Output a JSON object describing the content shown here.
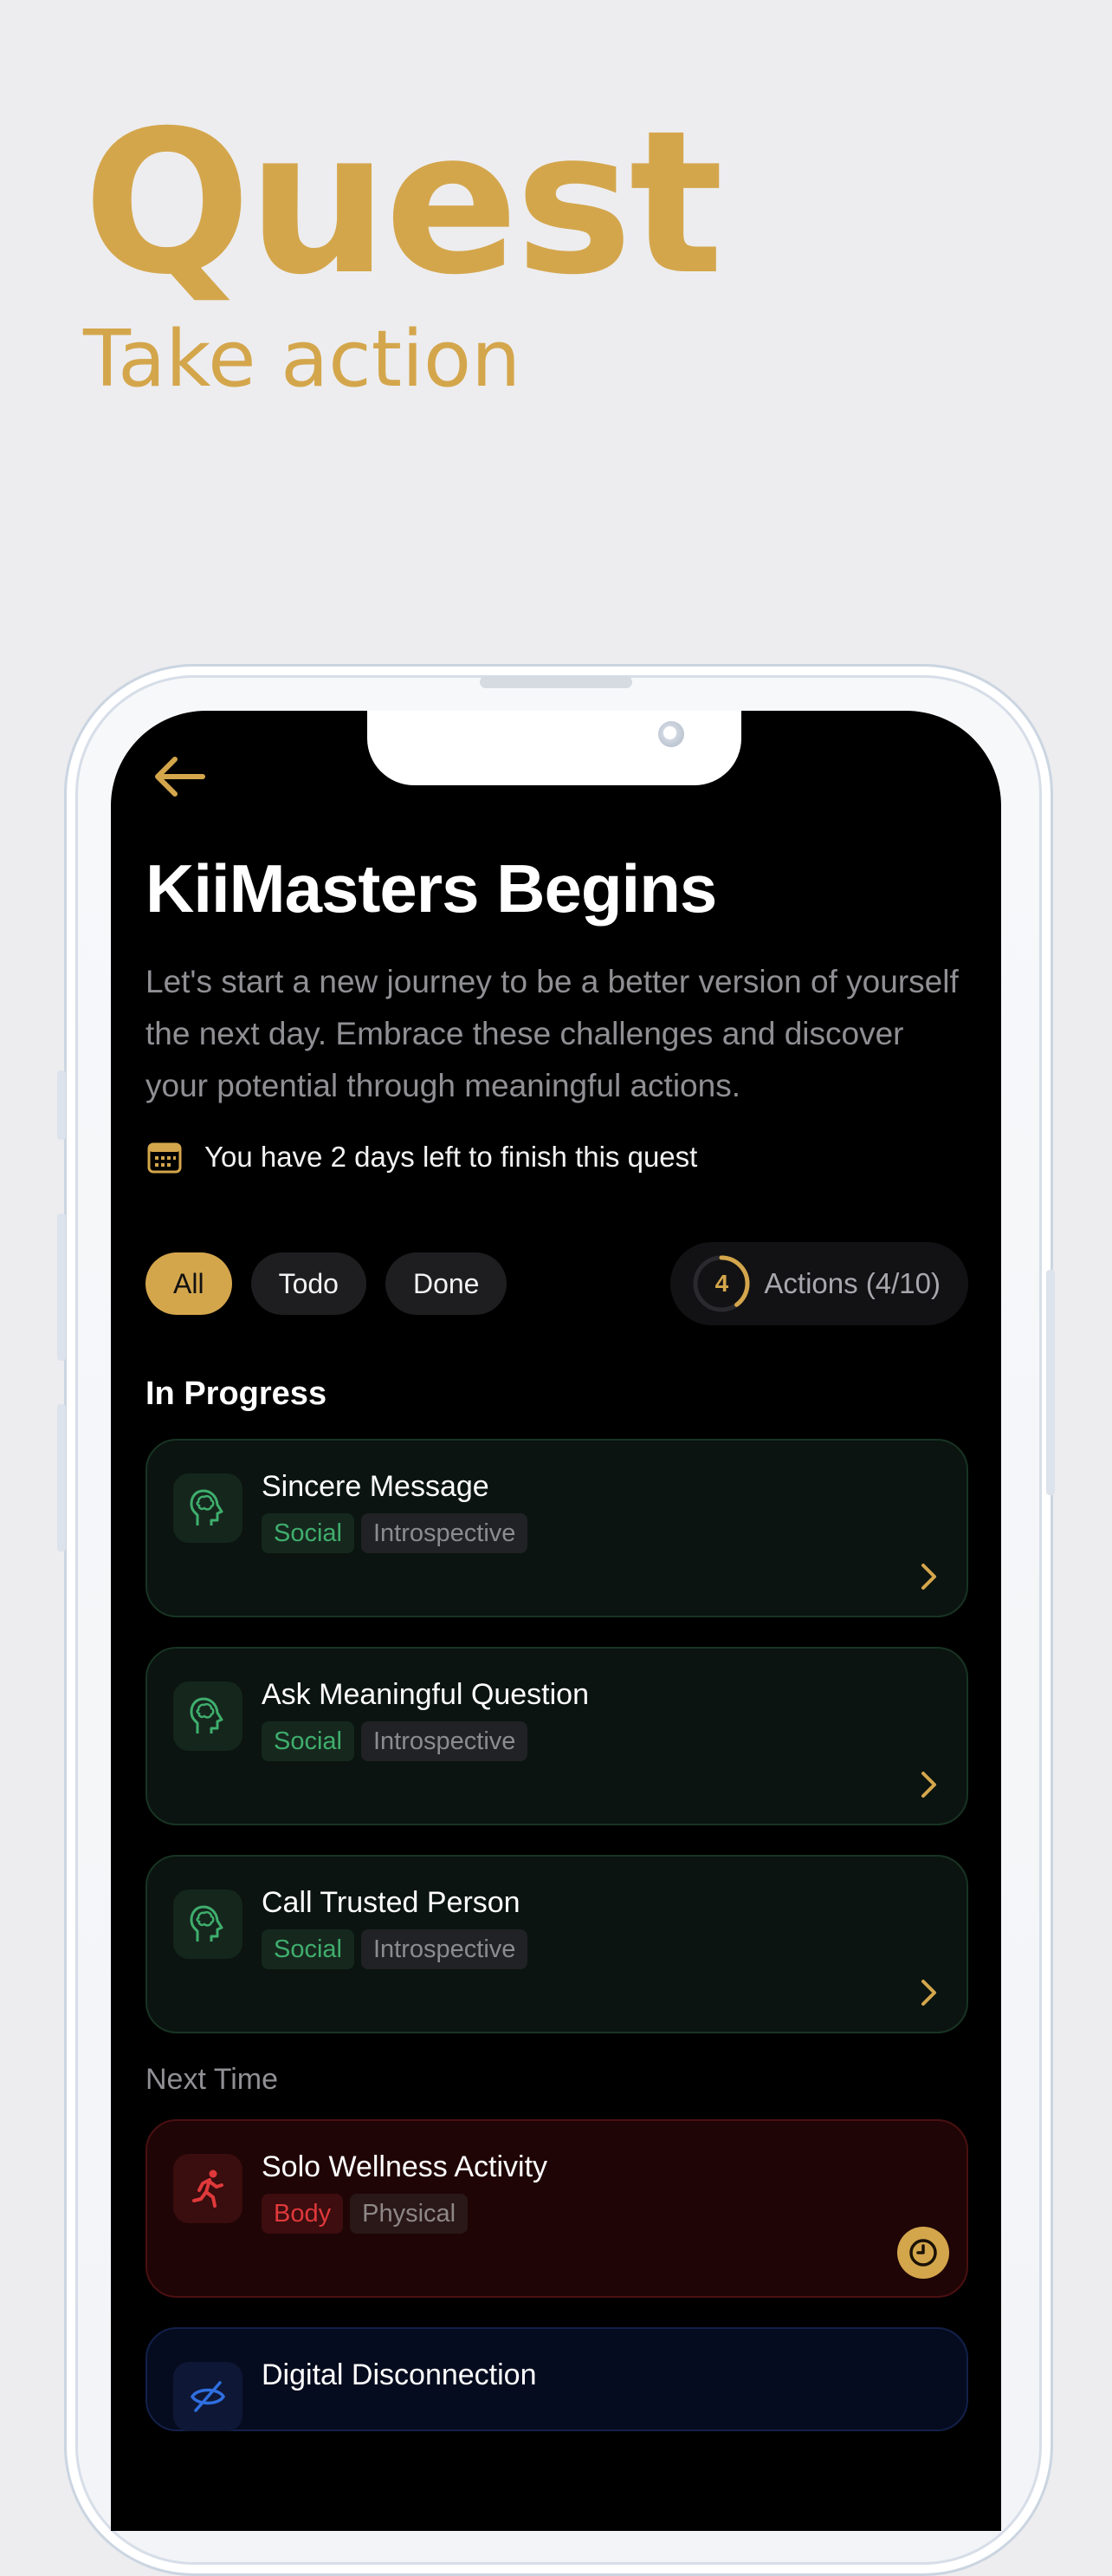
{
  "hero": {
    "title": "Quest",
    "subtitle": "Take action"
  },
  "quest": {
    "title": "KiiMasters Begins",
    "description": "Let's start a new journey to be a better version of yourself the next day. Embrace these challenges and discover your potential through meaningful actions.",
    "deadline": "You have 2 days left to finish this quest"
  },
  "filters": {
    "all": "All",
    "todo": "Todo",
    "done": "Done",
    "active": "All"
  },
  "actions_progress": {
    "count": "4",
    "label": "Actions (4/10)",
    "completed": 4,
    "total": 10
  },
  "sections": {
    "in_progress": "In Progress",
    "next_time": "Next Time"
  },
  "in_progress": [
    {
      "name": "Sincere Message",
      "tags": [
        "Social",
        "Introspective"
      ]
    },
    {
      "name": "Ask Meaningful Question",
      "tags": [
        "Social",
        "Introspective"
      ]
    },
    {
      "name": "Call Trusted Person",
      "tags": [
        "Social",
        "Introspective"
      ]
    }
  ],
  "next_time": [
    {
      "name": "Solo Wellness Activity",
      "tags": [
        "Body",
        "Physical"
      ]
    },
    {
      "name": "Digital Disconnection",
      "tags": []
    }
  ],
  "colors": {
    "accent": "#d4a64c",
    "background": "#ededef",
    "screen": "#000000",
    "social_green": "#3fae6d",
    "body_red": "#e0393b"
  },
  "icons": {
    "back": "arrow-left-icon",
    "deadline": "calendar-icon",
    "social_card": "head-brain-icon",
    "body_card": "running-person-icon",
    "digital_card": "eye-off-icon",
    "open": "chevron-right-icon",
    "scheduled": "clock-icon"
  }
}
